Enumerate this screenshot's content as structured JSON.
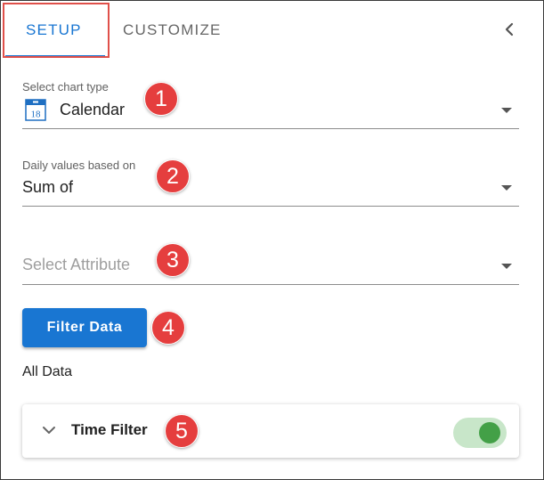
{
  "tabs": [
    {
      "label": "SETUP",
      "active": true
    },
    {
      "label": "CUSTOMIZE",
      "active": false
    }
  ],
  "chart_type": {
    "label": "Select chart type",
    "value": "Calendar",
    "icon": "calendar-icon",
    "icon_text": "18"
  },
  "daily_values": {
    "label": "Daily values based on",
    "value": "Sum of"
  },
  "attribute": {
    "placeholder": "Select Attribute"
  },
  "filter_button": {
    "label": "Filter Data"
  },
  "filter_status": "All Data",
  "time_filter": {
    "title": "Time Filter",
    "enabled": true
  },
  "annotations": [
    "1",
    "2",
    "3",
    "4",
    "5"
  ],
  "colors": {
    "accent": "#1976d2",
    "annotation": "#e53e3e",
    "toggle_on": "#43a047",
    "highlight_box": "#e0504a"
  }
}
